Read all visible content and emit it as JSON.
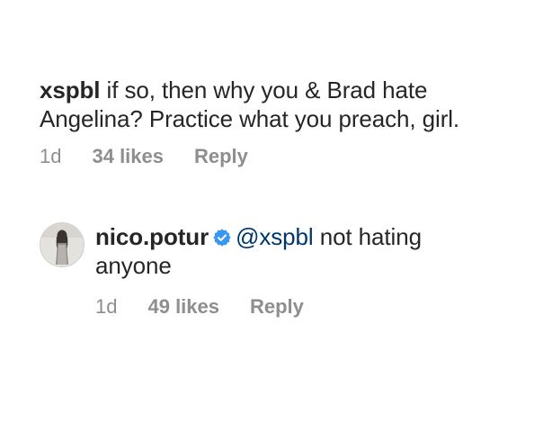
{
  "comment1": {
    "username": "xspbl",
    "text": " if so, then why you & Brad hate",
    "text_line2": "Angelina? Practice what you preach, girl.",
    "time": "1d",
    "likes": "34 likes",
    "reply": "Reply"
  },
  "reply1": {
    "username": "nico.potur",
    "mention": "@xspbl",
    "text": " not hating",
    "text_line2": "anyone",
    "time": "1d",
    "likes": "49 likes",
    "reply": "Reply",
    "verified_icon": "verified-badge-icon",
    "verified_color": "#3897f0"
  }
}
